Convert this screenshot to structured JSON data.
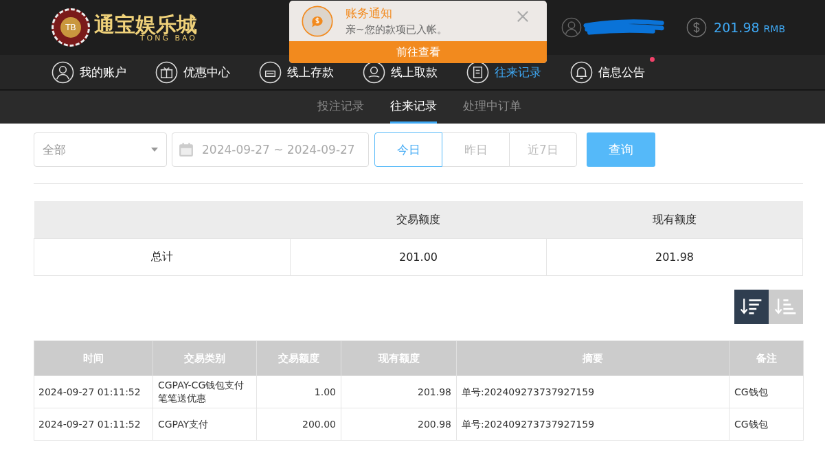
{
  "header": {
    "logo": {
      "badge": "TB",
      "name": "通宝娱乐城",
      "sub": "TONG BAO"
    },
    "user": {
      "redacted": true
    },
    "balance": {
      "amount": "201.98",
      "currency": "RMB"
    }
  },
  "nav": [
    {
      "label": "我的账户",
      "kind": "user",
      "selected": false,
      "dot": false
    },
    {
      "label": "优惠中心",
      "kind": "gift",
      "selected": false,
      "dot": false
    },
    {
      "label": "线上存款",
      "kind": "deposit",
      "selected": false,
      "dot": false
    },
    {
      "label": "线上取款",
      "kind": "withdraw",
      "selected": false,
      "dot": false
    },
    {
      "label": "往来记录",
      "kind": "records",
      "selected": true,
      "dot": false
    },
    {
      "label": "信息公告",
      "kind": "bell",
      "selected": false,
      "dot": true
    }
  ],
  "subtabs": [
    {
      "label": "投注记录",
      "selected": false
    },
    {
      "label": "往来记录",
      "selected": true
    },
    {
      "label": "处理中订单",
      "selected": false
    }
  ],
  "filters": {
    "type": "全部",
    "date": "2024-09-27 ~ 2024-09-27",
    "quick": [
      {
        "label": "今日",
        "selected": true
      },
      {
        "label": "昨日",
        "selected": false
      },
      {
        "label": "近7日",
        "selected": false
      }
    ],
    "search": "查询"
  },
  "summary": {
    "columns": [
      "",
      "交易额度",
      "现有额度"
    ],
    "rows": [
      [
        "总计",
        "201.00",
        "201.98"
      ]
    ]
  },
  "sort": [
    {
      "kind": "desc",
      "selected": true
    },
    {
      "kind": "asc",
      "selected": false
    }
  ],
  "table": {
    "columns": [
      "时间",
      "交易类别",
      "交易额度",
      "现有额度",
      "摘要",
      "备注"
    ],
    "rows": [
      [
        "2024-09-27 01:11:52",
        "CGPAY-CG钱包支付笔笔送优惠",
        "1.00",
        "201.98",
        "单号:202409273737927159",
        "CG钱包"
      ],
      [
        "2024-09-27 01:11:52",
        "CGPAY支付",
        "200.00",
        "200.98",
        "单号:202409273737927159",
        "CG钱包"
      ]
    ]
  },
  "notification": {
    "title": "账务通知",
    "message": "亲~您的款项已入帐。",
    "action": "前往查看"
  }
}
